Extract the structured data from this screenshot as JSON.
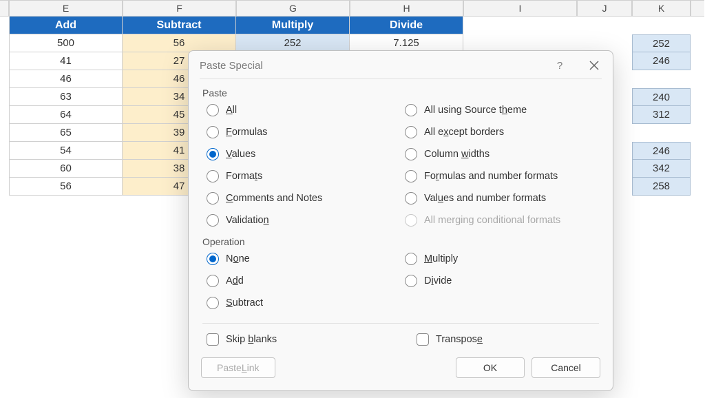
{
  "columns": {
    "e": "E",
    "f": "F",
    "g": "G",
    "h": "H",
    "i": "I",
    "j": "J",
    "k": "K"
  },
  "headers": {
    "e": "Add",
    "f": "Subtract",
    "g": "Multiply",
    "h": "Divide"
  },
  "table": {
    "rows": [
      {
        "e": "500",
        "f": "56",
        "g": "252",
        "h": "7.125"
      },
      {
        "e": "41",
        "f": "27"
      },
      {
        "e": "46",
        "f": "46"
      },
      {
        "e": "63",
        "f": "34"
      },
      {
        "e": "64",
        "f": "45"
      },
      {
        "e": "65",
        "f": "39"
      },
      {
        "e": "54",
        "f": "41"
      },
      {
        "e": "60",
        "f": "38"
      },
      {
        "e": "56",
        "f": "47"
      }
    ]
  },
  "side_k": [
    "252",
    "246",
    "",
    "240",
    "312",
    "",
    "246",
    "342",
    "258"
  ],
  "chart_data": {
    "type": "table",
    "columns": [
      "Add",
      "Subtract",
      "Multiply",
      "Divide"
    ],
    "rows": [
      [
        500,
        56,
        252,
        7.125
      ],
      [
        41,
        27,
        null,
        null
      ],
      [
        46,
        46,
        null,
        null
      ],
      [
        63,
        34,
        null,
        null
      ],
      [
        64,
        45,
        null,
        null
      ],
      [
        65,
        39,
        null,
        null
      ],
      [
        54,
        41,
        null,
        null
      ],
      [
        60,
        38,
        null,
        null
      ],
      [
        56,
        47,
        null,
        null
      ]
    ],
    "aux_k": [
      252,
      246,
      null,
      240,
      312,
      null,
      246,
      342,
      258
    ]
  },
  "dialog": {
    "title": "Paste Special",
    "help": "?",
    "sections": {
      "paste": "Paste",
      "operation": "Operation"
    },
    "paste": {
      "all": "All",
      "formulas": "Formulas",
      "values": "Values",
      "formats": "Formats",
      "comments": "Comments and Notes",
      "validation": "Validation",
      "src_theme": "All using Source theme",
      "except_borders": "All except borders",
      "col_widths": "Column widths",
      "formulas_numfmt": "Formulas and number formats",
      "values_numfmt": "Values and number formats",
      "merging_cond": "All merging conditional formats"
    },
    "operation": {
      "none": "None",
      "add": "Add",
      "subtract": "Subtract",
      "multiply": "Multiply",
      "divide": "Divide"
    },
    "checks": {
      "skip_blanks": "Skip blanks",
      "transpose": "Transpose"
    },
    "buttons": {
      "paste_link": "Paste Link",
      "ok": "OK",
      "cancel": "Cancel"
    }
  }
}
